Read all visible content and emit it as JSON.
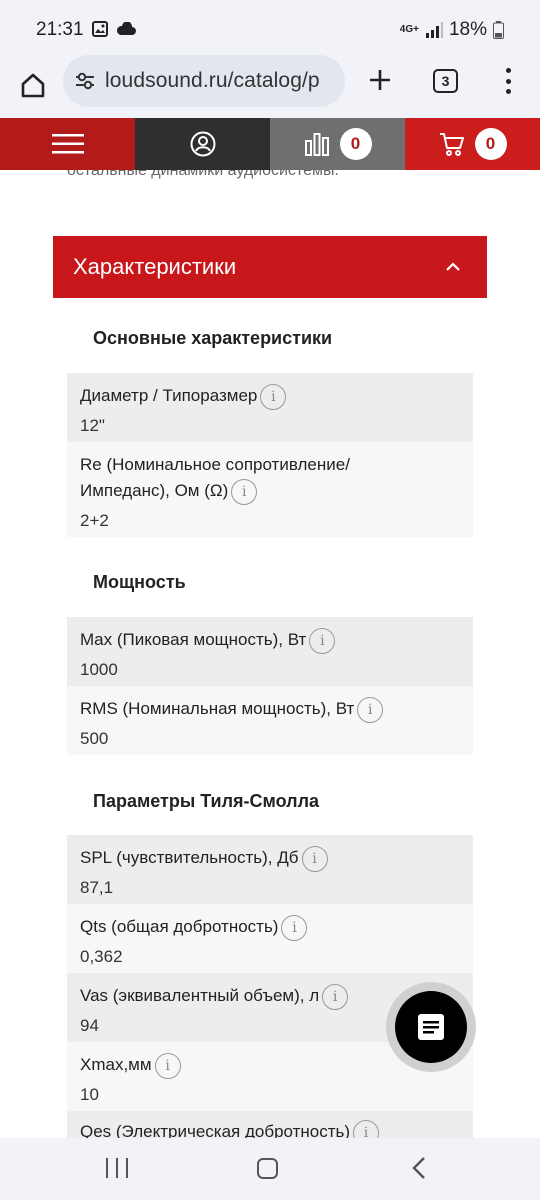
{
  "status_bar": {
    "time": "21:31",
    "network": "4G+",
    "battery": "18%"
  },
  "browser": {
    "url": "loudsound.ru/catalog/p",
    "tab_count": "3"
  },
  "site_nav": {
    "compare_count": "0",
    "cart_count": "0"
  },
  "content": {
    "cut_text": "остальные динамики аудиосистемы.",
    "section_title": "Характеристики",
    "groups": [
      {
        "title": "Основные характеристики",
        "rows": [
          {
            "label": "Диаметр / Типоразмер",
            "value": "12\""
          },
          {
            "label": "Re (Номинальное сопротивление/ Импеданс), Ом (Ω)",
            "value": "2+2"
          }
        ]
      },
      {
        "title": "Мощность",
        "rows": [
          {
            "label": "Max (Пиковая мощность), Вт",
            "value": "1000"
          },
          {
            "label": "RMS (Номинальная мощность), Вт",
            "value": "500"
          }
        ]
      },
      {
        "title": "Параметры Тиля-Смолла",
        "rows": [
          {
            "label": "SPL (чувствительность), Дб",
            "value": "87,1"
          },
          {
            "label": "Qts (общая добротность)",
            "value": "0,362"
          },
          {
            "label": "Vas (эквивалентный объем), л",
            "value": "94"
          },
          {
            "label": "Xmax,мм",
            "value": "10"
          },
          {
            "label": "Qes (Электрическая добротность)",
            "value": ""
          }
        ]
      }
    ]
  },
  "colors": {
    "brand_red": "#c8171a",
    "dark": "#2f2f2f",
    "gray": "#6f6f6f"
  }
}
